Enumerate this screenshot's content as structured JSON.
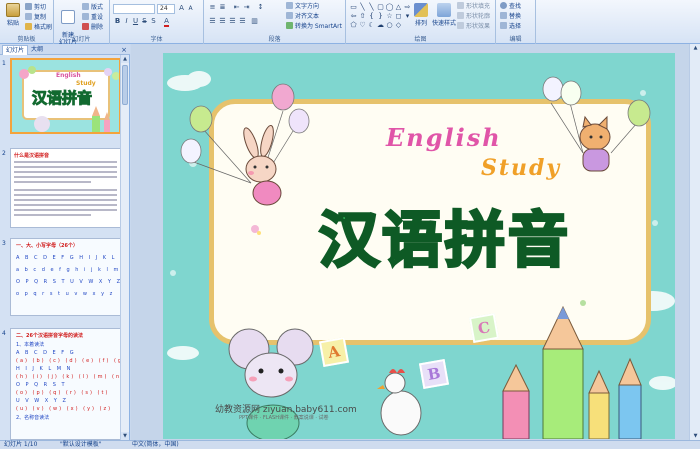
{
  "ribbon": {
    "clipboard": {
      "paste": "粘贴",
      "cut": "剪切",
      "copy": "复制",
      "format_painter": "格式刷",
      "label": "剪贴板"
    },
    "slides": {
      "new_slide": "新建\n幻灯片",
      "layout": "版式",
      "reset": "重设",
      "delete": "删除",
      "label": "幻灯片"
    },
    "font": {
      "font_name": "",
      "font_size": "24",
      "label": "字体"
    },
    "paragraph": {
      "text_direction": "文字方向",
      "align_text": "对齐文本",
      "smartart": "转换为 SmartArt",
      "label": "段落"
    },
    "drawing": {
      "arrange": "排列",
      "quick_styles": "快速样式",
      "shape_fill": "形状填充",
      "shape_outline": "形状轮廓",
      "shape_effects": "形状效果",
      "label": "绘图"
    },
    "editing": {
      "find": "查找",
      "replace": "替换",
      "select": "选择",
      "label": "编辑"
    }
  },
  "pane": {
    "tabs": [
      "幻灯片",
      "大纲"
    ],
    "close": "×"
  },
  "thumbnails": [
    {
      "number": "1",
      "english": "English",
      "study": "Study",
      "title": "汉语拼音"
    },
    {
      "number": "2",
      "heading": "什么是汉语拼音"
    },
    {
      "number": "3",
      "heading": "一、大、小写字母（26个）",
      "rows": [
        "A B C D E F G H I J K L M N",
        "a b c d e f g h i j k l m n",
        "O P Q R S T U V W X Y Z",
        "o p q r s t u v w x y z"
      ]
    },
    {
      "number": "4",
      "heading": "二、26个汉语拼音字母的读法",
      "sub1": "1、本着读法",
      "rows": [
        "A  B  C  D  E  F  G",
        "(a)  (b)  (c)  (d)  (e)  (f)  (g)",
        "H  I  J  K  L  M  N",
        "(h)  (i)  (j)  (k)  (l)  (m)  (n)",
        "O  P  Q  R  S  T",
        "(o)  (p)  (q)  (r)  (s)  (t)",
        "U  V  W  X  Y  Z",
        "(u)  (v)  (w)  (x)  (y)  (z)"
      ],
      "sub2": "2、名称音读法"
    }
  ],
  "slide": {
    "english": "English",
    "study": "Study",
    "title": "汉语拼音",
    "block_a": "A",
    "block_b": "B",
    "block_c": "C",
    "watermark": "幼教资源网 ziyuan.baby611.com",
    "watermark_sub": "PPT课件 · FLASH课件 · 教案说课 · 试卷",
    "colors": {
      "background": "#7fd6cf",
      "board": "#fffdf3",
      "frame": "#e6c26c",
      "title_fill": "#3fd06a",
      "title_stroke": "#0e5a25",
      "english": "#e055a8",
      "study": "#f0a028"
    }
  },
  "status": {
    "slide_counter": "幻灯片 1/10",
    "theme": "\"默认设计模板\"",
    "language": "中文(简体，中国)"
  }
}
